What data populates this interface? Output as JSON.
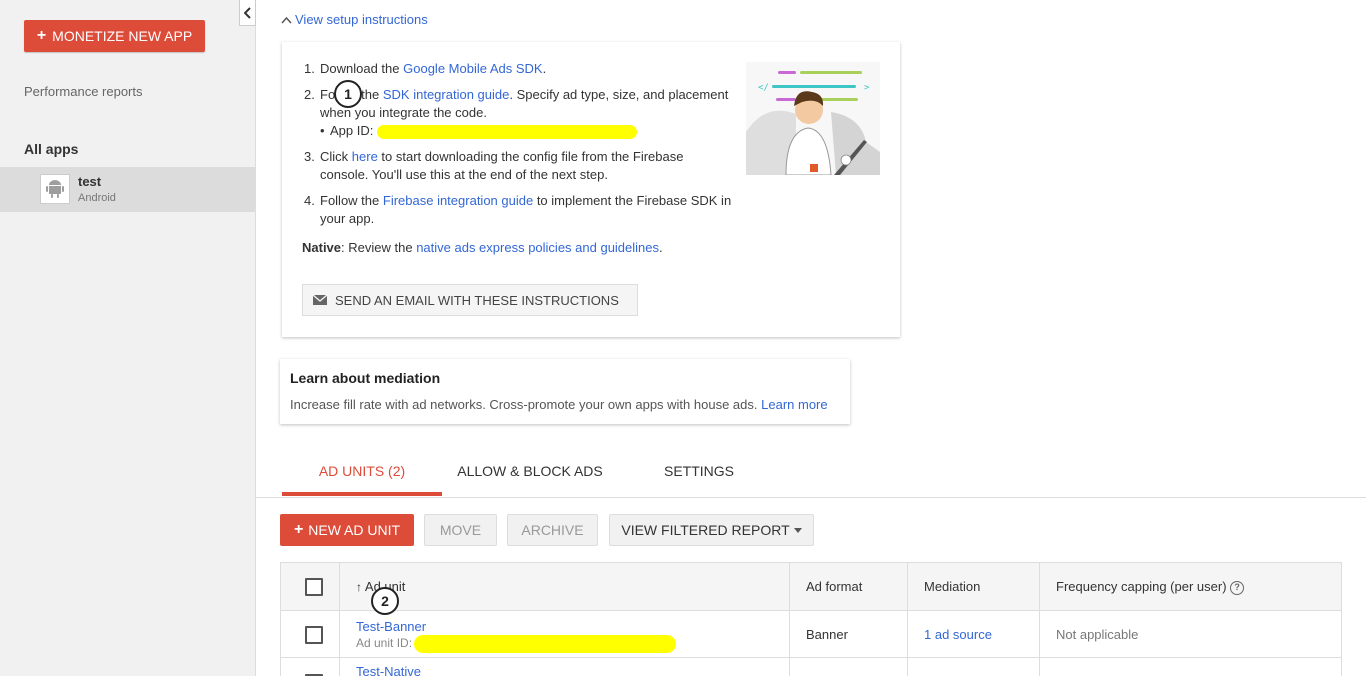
{
  "sidebar": {
    "monetize_label": "MONETIZE NEW APP",
    "performance_reports": "Performance reports",
    "all_apps": "All apps",
    "app": {
      "name": "test",
      "platform": "Android"
    }
  },
  "setup": {
    "toggle_label": "View setup instructions",
    "step1": {
      "num": "1.",
      "before": "Download the ",
      "link": "Google Mobile Ads SDK",
      "after": "."
    },
    "step2": {
      "num": "2.",
      "before": "Follow the ",
      "link": "SDK integration guide",
      "after": ". Specify ad type, size, and placement when you integrate the code.",
      "app_id_label": "App ID:"
    },
    "step3": {
      "num": "3.",
      "before": "Click ",
      "link": "here",
      "after": " to start downloading the config file from the Firebase console. You'll use this at the end of the next step."
    },
    "step4": {
      "num": "4.",
      "before": "Follow the ",
      "link": "Firebase integration guide",
      "after": " to implement the Firebase SDK in your app."
    },
    "native": {
      "label": "Native",
      "before": ": Review the ",
      "link": "native ads express policies and guidelines",
      "after": "."
    },
    "email_button": "SEND AN EMAIL WITH THESE INSTRUCTIONS"
  },
  "annotations": {
    "a1": "1",
    "a2": "2"
  },
  "mediation": {
    "title": "Learn about mediation",
    "desc": "Increase fill rate with ad networks. Cross-promote your own apps with house ads.",
    "link": "Learn more"
  },
  "tabs": [
    "AD UNITS (2)",
    "ALLOW & BLOCK ADS",
    "SETTINGS"
  ],
  "toolbar": {
    "new_ad_unit": "NEW AD UNIT",
    "move": "MOVE",
    "archive": "ARCHIVE",
    "view_filtered_report": "VIEW FILTERED REPORT"
  },
  "table": {
    "headers": {
      "ad_unit": "Ad unit",
      "ad_format": "Ad format",
      "mediation": "Mediation",
      "frequency_capping": "Frequency capping (per user)"
    },
    "rows": [
      {
        "name": "Test-Banner",
        "id_label": "Ad unit ID:",
        "format": "Banner",
        "mediation": "1 ad source",
        "frequency": "Not applicable"
      },
      {
        "name": "Test-Native"
      }
    ]
  },
  "colors": {
    "accent_red": "#dd4b39",
    "link_blue": "#3367d6",
    "highlight": "#ffff00"
  }
}
